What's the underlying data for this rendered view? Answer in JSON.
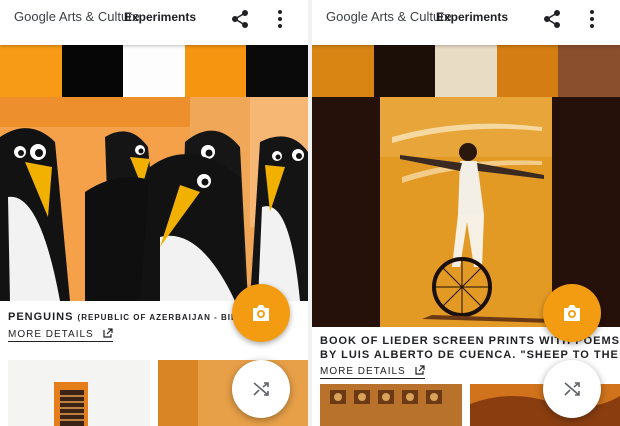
{
  "left": {
    "brand": "Google Arts & Culture",
    "section": "Experiments",
    "palette": [
      "#f79a16",
      "#060606",
      "#fdfdfd",
      "#f59510",
      "#0a0a0a"
    ],
    "artwork": {
      "title": "PENGUINS",
      "subtitle": "(REPUBLIC OF AZERBAIJAN - BIENNALE"
    },
    "more_details": "MORE DETAILS",
    "icons": {
      "share": "share-icon",
      "more": "more-vert-icon",
      "camera": "camera-icon",
      "shuffle": "shuffle-icon",
      "external": "open-in-new-icon"
    }
  },
  "right": {
    "brand": "Google Arts & Culture",
    "section": "Experiments",
    "palette": [
      "#d98514",
      "#1c0f08",
      "#e9dcc4",
      "#d47d12",
      "#8a4f2c"
    ],
    "artwork": {
      "title_line1": "BOOK OF LIEDER SCREEN PRINTS WITH POEMS",
      "title_line2": "BY LUIS ALBERTO DE CUENCA. \"SHEEP TO THE"
    },
    "more_details": "MORE DETAILS",
    "icons": {
      "share": "share-icon",
      "more": "more-vert-icon",
      "camera": "camera-icon",
      "shuffle": "shuffle-icon",
      "external": "open-in-new-icon"
    }
  },
  "colors": {
    "accent": "#f39c12",
    "text": "#202124"
  }
}
